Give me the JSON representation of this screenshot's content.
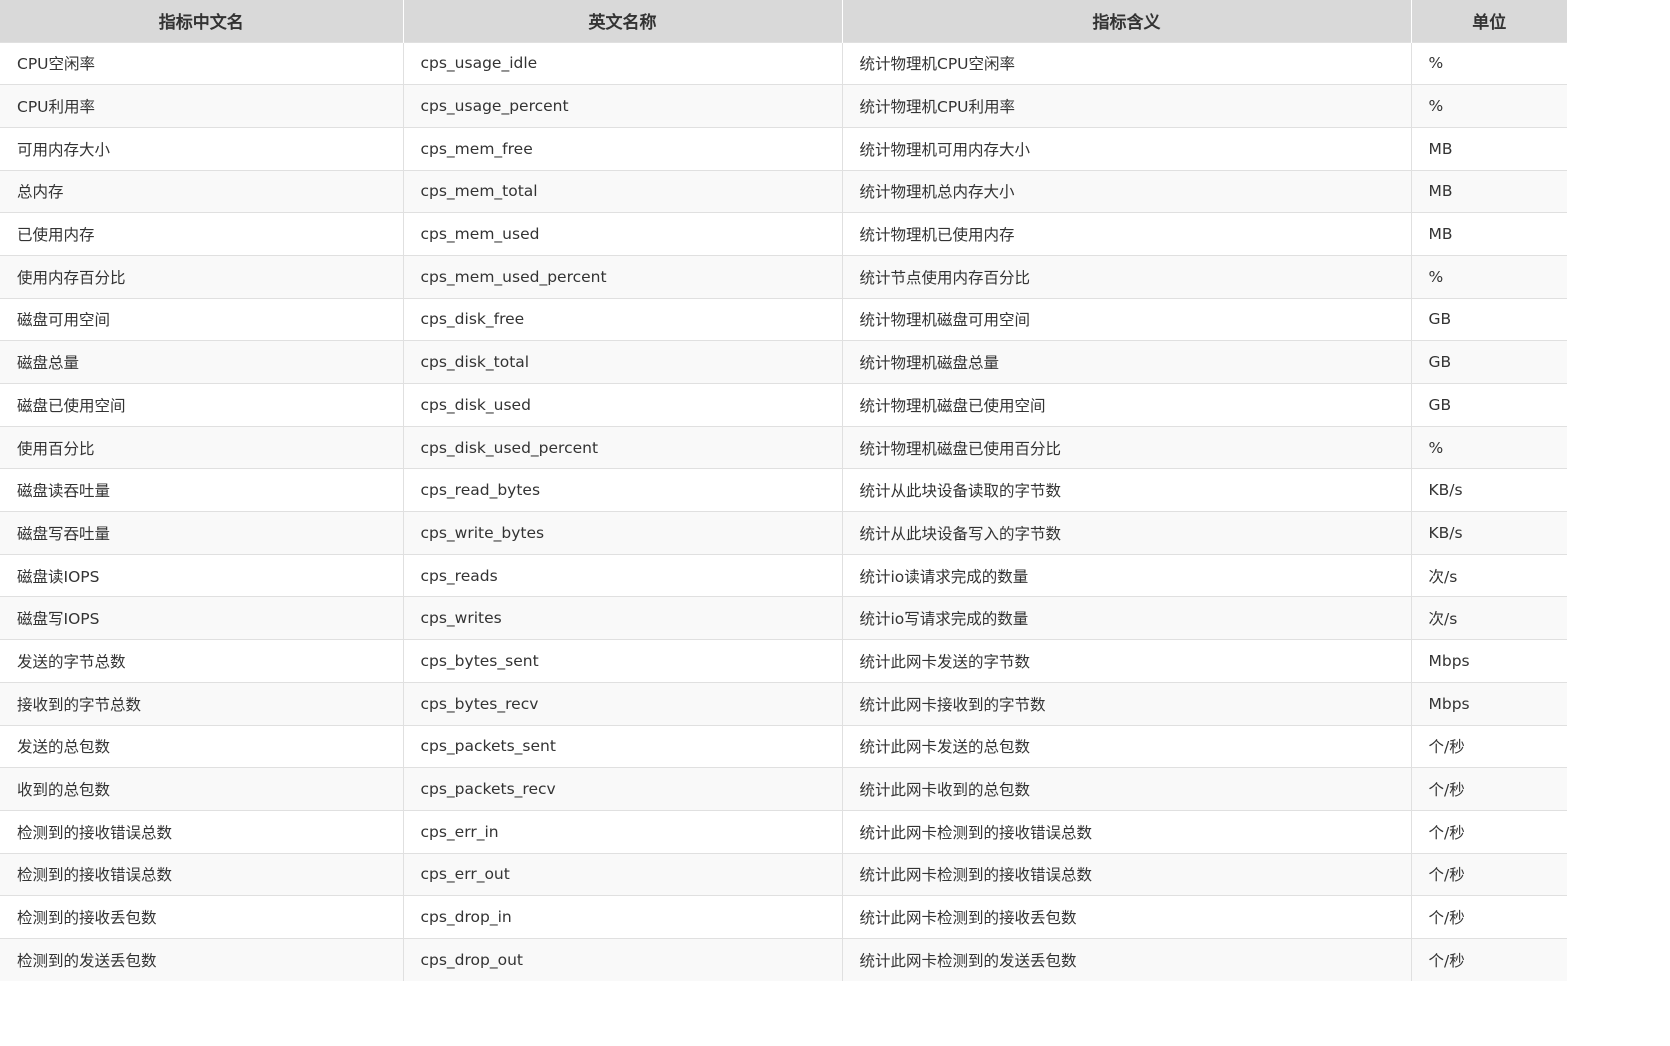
{
  "table": {
    "headers": [
      "指标中文名",
      "英文名称",
      "指标含义",
      "单位"
    ],
    "rows": [
      [
        "CPU空闲率",
        "cps_usage_idle",
        "统计物理机CPU空闲率",
        "%"
      ],
      [
        "CPU利用率",
        "cps_usage_percent",
        "统计物理机CPU利用率",
        "%"
      ],
      [
        "可用内存大小",
        "cps_mem_free",
        "统计物理机可用内存大小",
        "MB"
      ],
      [
        "总内存",
        "cps_mem_total",
        "统计物理机总内存大小",
        "MB"
      ],
      [
        "已使用内存",
        "cps_mem_used",
        "统计物理机已使用内存",
        "MB"
      ],
      [
        "使用内存百分比",
        "cps_mem_used_percent",
        "统计节点使用内存百分比",
        "%"
      ],
      [
        "磁盘可用空间",
        "cps_disk_free",
        "统计物理机磁盘可用空间",
        "GB"
      ],
      [
        "磁盘总量",
        "cps_disk_total",
        "统计物理机磁盘总量",
        "GB"
      ],
      [
        "磁盘已使用空间",
        "cps_disk_used",
        "统计物理机磁盘已使用空间",
        "GB"
      ],
      [
        "使用百分比",
        "cps_disk_used_percent",
        "统计物理机磁盘已使用百分比",
        "%"
      ],
      [
        "磁盘读吞吐量",
        "cps_read_bytes",
        "统计从此块设备读取的字节数",
        "KB/s"
      ],
      [
        "磁盘写吞吐量",
        "cps_write_bytes",
        "统计从此块设备写入的字节数",
        "KB/s"
      ],
      [
        "磁盘读IOPS",
        "cps_reads",
        "统计io读请求完成的数量",
        "次/s"
      ],
      [
        "磁盘写IOPS",
        "cps_writes",
        "统计io写请求完成的数量",
        "次/s"
      ],
      [
        "发送的字节总数",
        "cps_bytes_sent",
        "统计此网卡发送的字节数",
        "Mbps"
      ],
      [
        "接收到的字节总数",
        "cps_bytes_recv",
        "统计此网卡接收到的字节数",
        "Mbps"
      ],
      [
        "发送的总包数",
        "cps_packets_sent",
        "统计此网卡发送的总包数",
        "个/秒"
      ],
      [
        "收到的总包数",
        "cps_packets_recv",
        "统计此网卡收到的总包数",
        "个/秒"
      ],
      [
        "检测到的接收错误总数",
        "cps_err_in",
        "统计此网卡检测到的接收错误总数",
        "个/秒"
      ],
      [
        "检测到的接收错误总数",
        "cps_err_out",
        "统计此网卡检测到的接收错误总数",
        "个/秒"
      ],
      [
        "检测到的接收丢包数",
        "cps_drop_in",
        "统计此网卡检测到的接收丢包数",
        "个/秒"
      ],
      [
        "检测到的发送丢包数",
        "cps_drop_out",
        "统计此网卡检测到的发送丢包数",
        "个/秒"
      ]
    ]
  }
}
